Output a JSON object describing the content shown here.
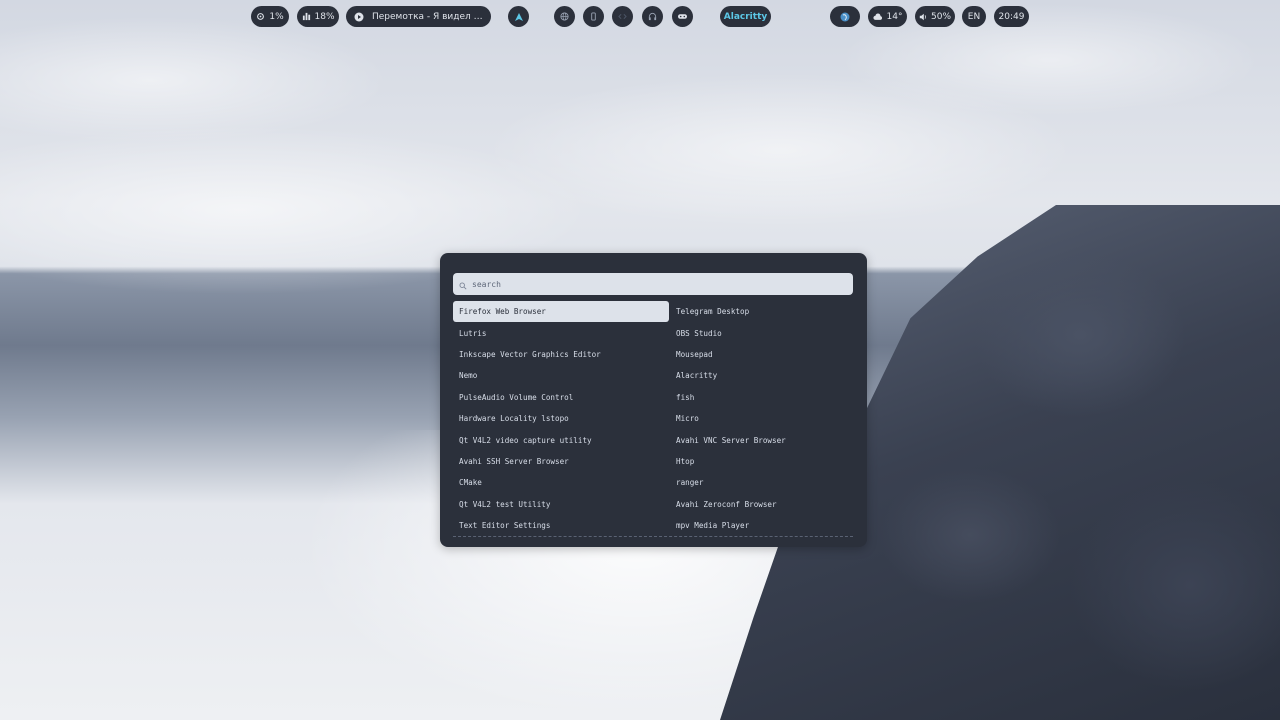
{
  "topbar": {
    "cpu": {
      "icon": "gear-cpu-icon",
      "value": "1%"
    },
    "memory": {
      "icon": "bar-chart-icon",
      "value": "18%"
    },
    "media": {
      "icon": "play-icon",
      "title": "Перемотка - Я видел сон..."
    },
    "arch_icon": "arch-logo-icon",
    "tray_icons": [
      "globe-icon",
      "phone-icon",
      "code-icon",
      "headphones-icon",
      "gamepad-icon"
    ],
    "active_window": "Alacritty",
    "network_icon": "network-globe-icon",
    "weather": {
      "icon": "cloud-icon",
      "value": "14°"
    },
    "volume": {
      "icon": "speaker-icon",
      "value": "50%"
    },
    "language": "EN",
    "clock": "20:49",
    "accent_color": "#5cc7e6"
  },
  "launcher": {
    "search": {
      "placeholder": "search",
      "value": ""
    },
    "left_column": [
      "Firefox Web Browser",
      "Lutris",
      "Inkscape Vector Graphics Editor",
      "Nemo",
      "PulseAudio Volume Control",
      "Hardware Locality lstopo",
      "Qt V4L2 video capture utility",
      "Avahi SSH Server Browser",
      "CMake",
      "Qt V4L2 test Utility",
      "Text Editor Settings"
    ],
    "right_column": [
      "Telegram Desktop",
      "OBS Studio",
      "Mousepad",
      "Alacritty",
      "fish",
      "Micro",
      "Avahi VNC Server Browser",
      "Htop",
      "ranger",
      "Avahi Zeroconf Browser",
      "mpv Media Player"
    ],
    "selected": "Firefox Web Browser"
  }
}
